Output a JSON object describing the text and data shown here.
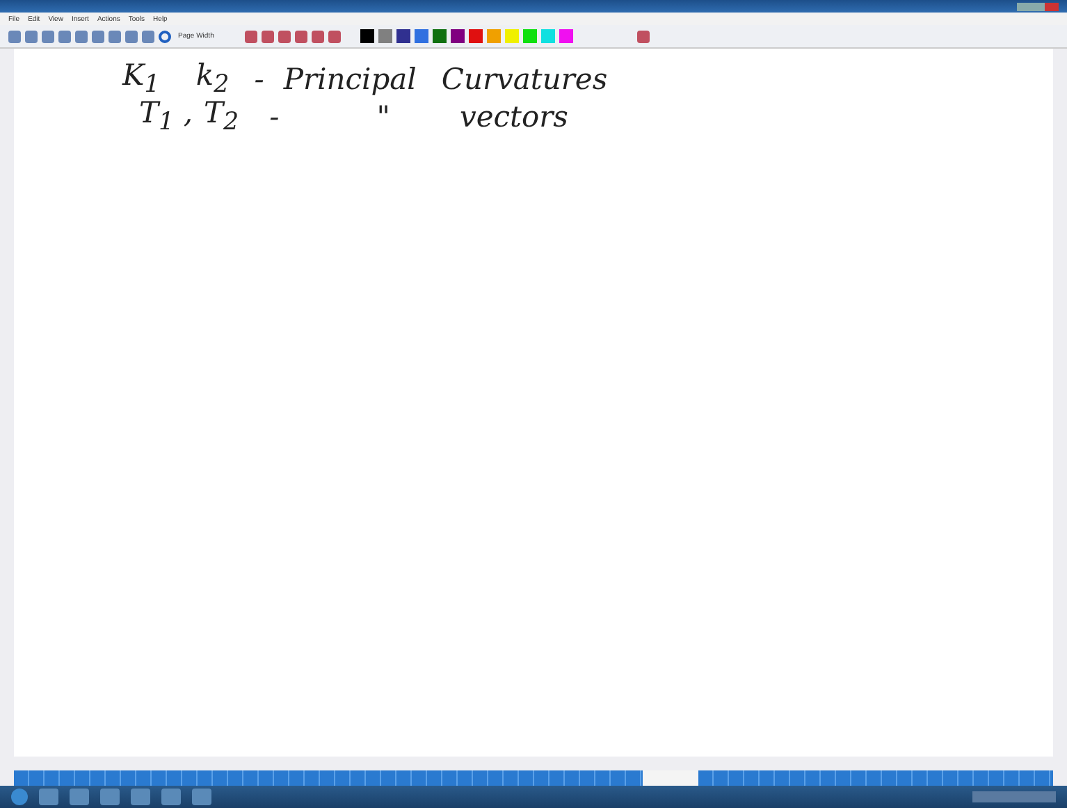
{
  "menu": [
    {
      "label": "File"
    },
    {
      "label": "Edit"
    },
    {
      "label": "View"
    },
    {
      "label": "Insert"
    },
    {
      "label": "Actions"
    },
    {
      "label": "Tools"
    },
    {
      "label": "Help"
    }
  ],
  "toolbar": {
    "zoom": "Page Width"
  },
  "pen_colors": [
    {
      "color": "#000000",
      "selected": false
    },
    {
      "color": "#808080",
      "selected": false
    },
    {
      "color": "#303090",
      "selected": false
    },
    {
      "color": "#3070e0",
      "selected": false
    },
    {
      "color": "#107010",
      "selected": false
    },
    {
      "color": "#800080",
      "selected": false
    },
    {
      "color": "#e01010",
      "selected": false
    },
    {
      "color": "#f0a000",
      "selected": false
    },
    {
      "color": "#f0f000",
      "selected": false
    },
    {
      "color": "#10e010",
      "selected": false
    },
    {
      "color": "#10e0e0",
      "selected": false
    },
    {
      "color": "#f010f0",
      "selected": false
    }
  ],
  "ink_lines": [
    [
      "K$_{1}$",
      "k$_{2}$",
      "-",
      "Principal",
      "Curvatures"
    ],
    [
      "T$_{1}$ ,",
      "T$_{2}$",
      "-",
      "\"",
      "vectors"
    ]
  ]
}
